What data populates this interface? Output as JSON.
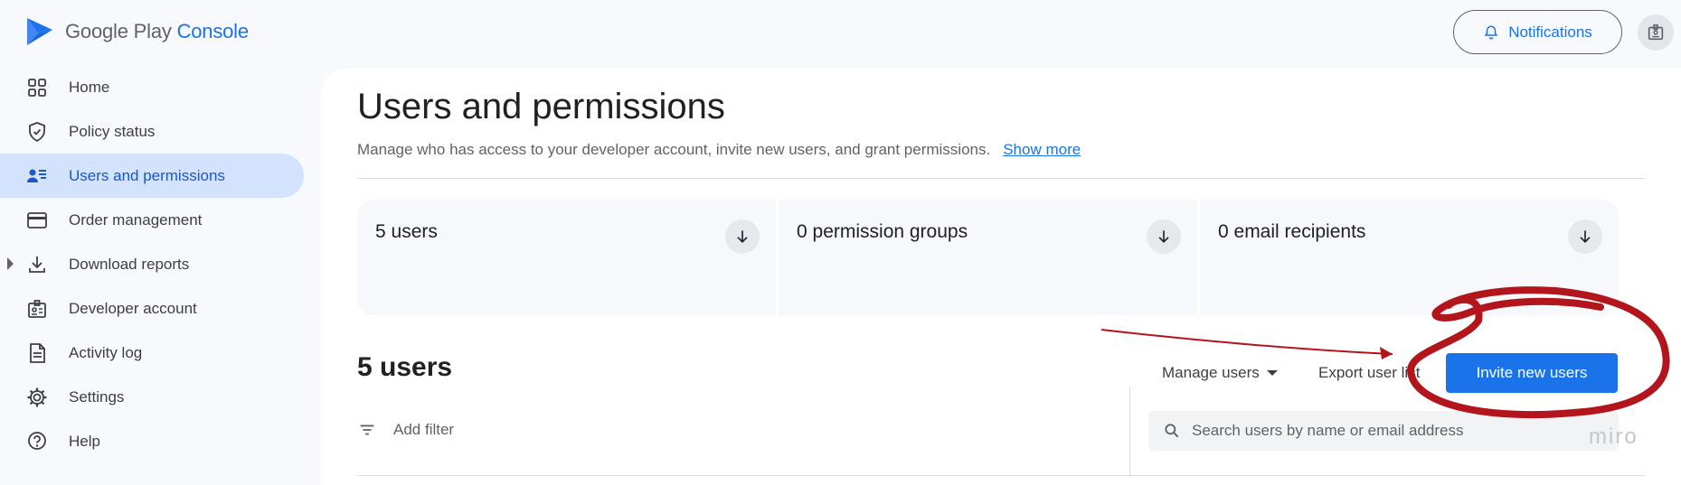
{
  "header": {
    "logo_word1": "Google Play",
    "logo_word2": "Console",
    "notifications_label": "Notifications"
  },
  "sidebar": {
    "items": [
      {
        "label": "Home",
        "icon": "grid-icon"
      },
      {
        "label": "Policy status",
        "icon": "shield-check-icon"
      },
      {
        "label": "Users and permissions",
        "icon": "users-list-icon",
        "active": true
      },
      {
        "label": "Order management",
        "icon": "credit-card-icon"
      },
      {
        "label": "Download reports",
        "icon": "download-icon",
        "expandable": true
      },
      {
        "label": "Developer account",
        "icon": "id-badge-icon"
      },
      {
        "label": "Activity log",
        "icon": "document-icon"
      },
      {
        "label": "Settings",
        "icon": "gear-icon"
      },
      {
        "label": "Help",
        "icon": "help-icon"
      }
    ]
  },
  "main": {
    "title": "Users and permissions",
    "description": "Manage who has access to your developer account, invite new users, and grant permissions.",
    "show_more": "Show more",
    "summary_cards": [
      {
        "label": "5 users"
      },
      {
        "label": "0 permission groups"
      },
      {
        "label": "0 email recipients"
      }
    ],
    "users_count": "5 users",
    "manage_users": "Manage users",
    "export_list": "Export user list",
    "invite_button": "Invite new users",
    "add_filter": "Add filter",
    "search_placeholder": "Search users by name or email address"
  },
  "watermark": "miro",
  "colors": {
    "accent": "#1a73e8",
    "active_nav_bg": "#d3e3fd",
    "annotation_red": "#b3151c"
  }
}
